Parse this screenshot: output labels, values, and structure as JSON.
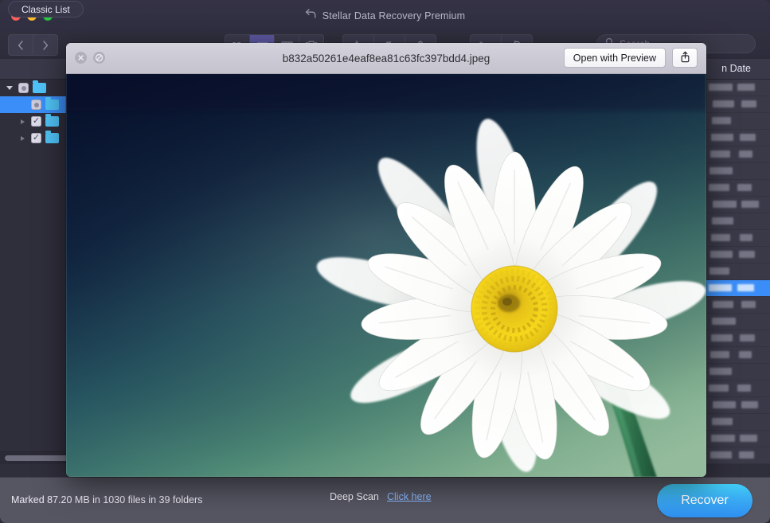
{
  "app": {
    "title": "Stellar Data Recovery Premium",
    "title_icon": "back-arrow-icon",
    "traffic_lights": [
      "close",
      "minimize",
      "zoom"
    ]
  },
  "toolbar": {
    "back_icon": "chevron-left-icon",
    "forward_icon": "chevron-right-icon",
    "view_buttons": [
      {
        "icon": "icon-view-icon",
        "active": false
      },
      {
        "icon": "list-view-icon",
        "active": true
      },
      {
        "icon": "column-view-icon",
        "active": false
      },
      {
        "icon": "gallery-view-icon",
        "active": false
      }
    ],
    "tool_buttons": [
      {
        "icon": "action-gear-icon"
      },
      {
        "icon": "arrange-icon"
      },
      {
        "icon": "help-icon"
      }
    ],
    "right_buttons": [
      {
        "icon": "cart-icon"
      },
      {
        "icon": "refresh-icon"
      }
    ],
    "search": {
      "icon": "search-icon",
      "placeholder": "Search",
      "value": ""
    }
  },
  "tabs": {
    "classic_list": "Classic List"
  },
  "columns": {
    "date_header": "n Date"
  },
  "tree": {
    "rows": [
      {
        "indent": 0,
        "disclosure": "open",
        "check": "dot",
        "folder": true,
        "label": ""
      },
      {
        "indent": 1,
        "disclosure": "none",
        "check": "dot",
        "folder": true,
        "label": "",
        "selected": true
      },
      {
        "indent": 1,
        "disclosure": "collapsed",
        "check": "checked",
        "folder": true,
        "label": ""
      },
      {
        "indent": 1,
        "disclosure": "collapsed",
        "check": "checked",
        "folder": true,
        "label": ""
      }
    ]
  },
  "date_rows": [
    {
      "selected": false
    },
    {
      "selected": false
    },
    {
      "selected": false
    },
    {
      "selected": false
    },
    {
      "selected": false
    },
    {
      "selected": false
    },
    {
      "selected": false
    },
    {
      "selected": false
    },
    {
      "selected": false
    },
    {
      "selected": false
    },
    {
      "selected": false
    },
    {
      "selected": false
    },
    {
      "selected": true
    },
    {
      "selected": false
    },
    {
      "selected": false
    },
    {
      "selected": false
    },
    {
      "selected": false
    },
    {
      "selected": false
    },
    {
      "selected": false
    },
    {
      "selected": false
    },
    {
      "selected": false
    },
    {
      "selected": false
    },
    {
      "selected": false
    }
  ],
  "statusbar": {
    "marked_text": "Marked 87.20 MB in 1030 files in 39 folders",
    "deep_scan_label": "Deep Scan",
    "deep_scan_link": "Click here",
    "recover_label": "Recover"
  },
  "quicklook": {
    "filename": "b832a50261e4eaf8ea81c63fc397bdd4.jpeg",
    "close_icon": "close-icon",
    "fullscreen_icon": "no-entry-icon",
    "open_with_label": "Open with Preview",
    "share_icon": "share-icon",
    "image": {
      "subject": "white daisy flower with yellow center on green stem",
      "background_top": "#0e1c3c",
      "background_mid": "#2e6b72",
      "background_bottom": "#8fb89a",
      "petal_color": "#fdfdfb",
      "center_color": "#f2cf18",
      "center_core": "#9a7a12",
      "stem_color": "#2e7d52"
    }
  },
  "colors": {
    "window_chrome": "#32323f",
    "accent_blue": "#3b8ef7",
    "recover_gradient_start": "#41cdf5",
    "recover_gradient_end": "#2f8ff0",
    "statusbar_bg": "#565663",
    "folder_blue": "#4fc3f7"
  }
}
